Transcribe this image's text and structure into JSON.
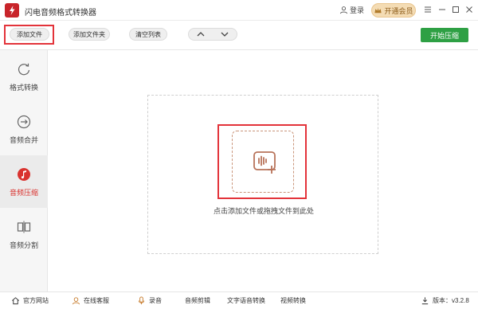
{
  "app": {
    "title": "闪电音频格式转换器"
  },
  "header": {
    "login_label": "登录",
    "vip_label": "开通会员",
    "minimize_icon": "minimize-icon",
    "maximize_icon": "maximize-icon",
    "close_icon": "close-icon"
  },
  "toolbar": {
    "add_file_label": "添加文件",
    "add_folder_label": "添加文件夹",
    "clear_list_label": "清空列表",
    "move_up_icon": "chevron-up-icon",
    "move_down_icon": "chevron-down-icon",
    "start_label": "开始压缩"
  },
  "sidebar": {
    "items": [
      {
        "label": "格式转换",
        "icon": "refresh-icon",
        "active": false
      },
      {
        "label": "音频合并",
        "icon": "merge-icon",
        "active": false
      },
      {
        "label": "音频压缩",
        "icon": "music-note-icon",
        "active": true
      },
      {
        "label": "音频分割",
        "icon": "split-icon",
        "active": false
      }
    ]
  },
  "main": {
    "drop_hint": "点击添加文件或拖拽文件到此处",
    "add_icon": "audio-add-icon"
  },
  "statusbar": {
    "items": [
      {
        "label": "官方网站",
        "icon": "home-icon"
      },
      {
        "label": "在线客服",
        "icon": "support-icon"
      },
      {
        "label": "录音",
        "icon": "record-icon"
      },
      {
        "label": "音频剪辑",
        "icon": ""
      },
      {
        "label": "文字语音转换",
        "icon": ""
      },
      {
        "label": "视频转换",
        "icon": ""
      }
    ],
    "version_label": "版本：v3.2.8"
  },
  "colors": {
    "accent_red": "#d9332f",
    "highlight_red": "#e3333a",
    "start_green": "#2ea044",
    "vip_gold": "#f4dcb4"
  }
}
